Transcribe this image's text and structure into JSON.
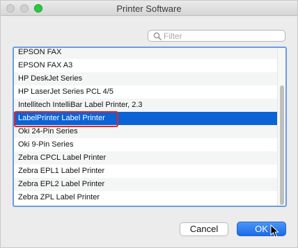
{
  "window": {
    "title": "Printer Software"
  },
  "filter": {
    "placeholder": "Filter",
    "value": ""
  },
  "list": {
    "items": [
      "EPSON FAX",
      "EPSON FAX A3",
      "HP DeskJet Series",
      "HP LaserJet Series PCL 4/5",
      "Intellitech IntelliBar Label Printer, 2.3",
      "LabelPrinter Label Printer",
      "Oki 24-Pin Series",
      "Oki 9-Pin Series",
      "Zebra CPCL Label Printer",
      "Zebra EPL1 Label Printer",
      "Zebra EPL2 Label Printer",
      "Zebra ZPL Label Printer"
    ],
    "selected": "LabelPrinter Label Printer"
  },
  "buttons": {
    "cancel": "Cancel",
    "ok": "OK"
  },
  "colors": {
    "selection": "#0b63d6",
    "highlight": "#e1252a",
    "ok_button": "#1a6be8",
    "zoom_button": "#2ac940"
  }
}
